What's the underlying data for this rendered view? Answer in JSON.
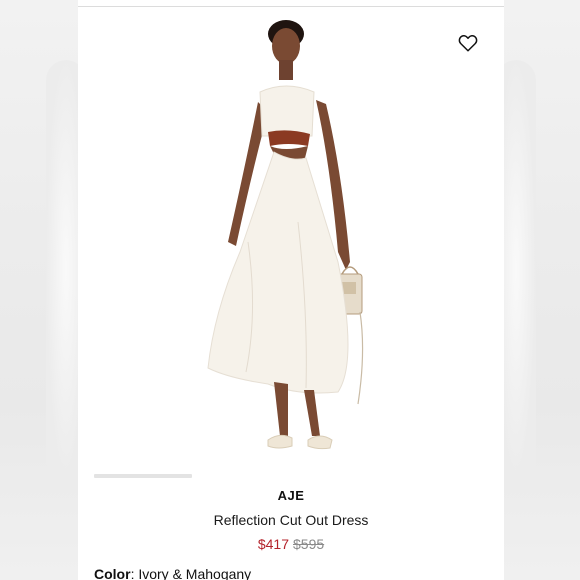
{
  "product": {
    "brand": "AJE",
    "name": "Reflection Cut Out Dress",
    "price_sale": "$417",
    "price_original": "$595",
    "color_label": "Color",
    "color_separator": ": ",
    "color_value": "Ivory & Mahogany"
  },
  "icons": {
    "wishlist": "heart-outline-icon"
  },
  "colors": {
    "sale_price": "#b4232b",
    "original_price": "#8a8a8a",
    "dress": "#f6f2ea",
    "waist_band": "#8b3a22",
    "skin": "#7a4a33"
  }
}
